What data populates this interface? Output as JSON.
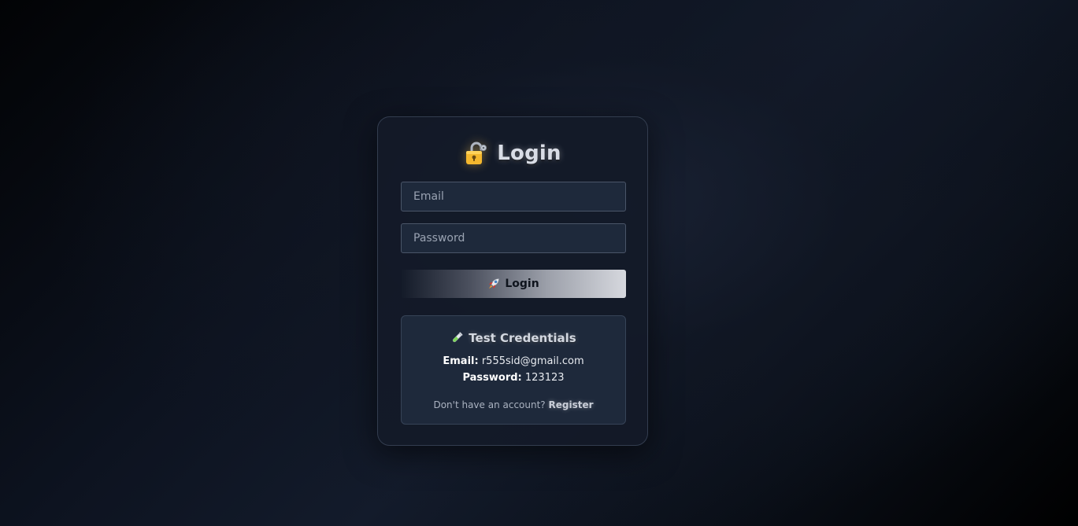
{
  "login_card": {
    "title": "Login",
    "title_icon": "lock-icon",
    "email_placeholder": "Email",
    "password_placeholder": "Password",
    "submit_label": "Login",
    "submit_icon": "rocket-icon"
  },
  "credentials": {
    "title": "Test Credentials",
    "title_icon": "test-tube-icon",
    "email_label": "Email:",
    "email_value": "r555sid@gmail.com",
    "password_label": "Password:",
    "password_value": "123123",
    "register_prompt": "Don't have an account?",
    "register_link": "Register"
  },
  "colors": {
    "card_background": "#131a28",
    "input_background": "#1e293b",
    "input_border": "#4a5568",
    "lock_gold": "#f5b82e"
  }
}
